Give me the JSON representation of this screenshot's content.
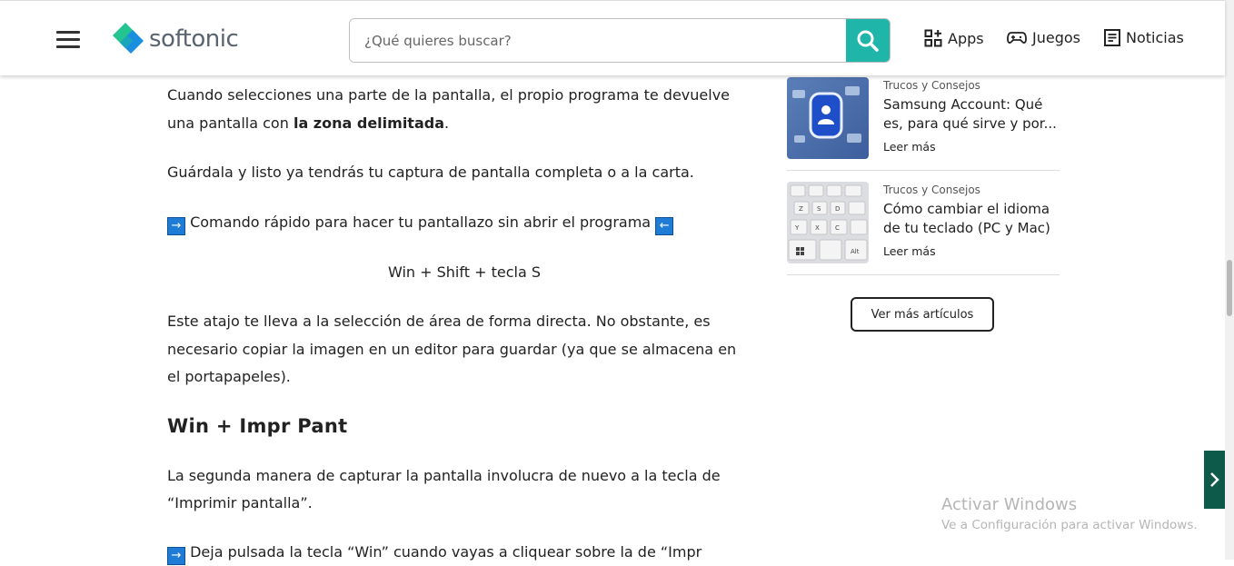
{
  "header": {
    "logo_text": "softonic",
    "search_placeholder": "¿Qué quieres buscar?",
    "nav": {
      "apps": "Apps",
      "juegos": "Juegos",
      "noticias": "Noticias"
    }
  },
  "article": {
    "p1_line1": "Cuando selecciones una parte de la pantalla, el propio programa te devuelve",
    "p1_line2_a": "una pantalla con ",
    "p1_line2_b": "la zona delimitada",
    "p1_line2_c": ".",
    "p2": "Guárdala y listo ya tendrás tu captura de pantalla completa o a la carta.",
    "arrow_left": "→",
    "arrow_right": "←",
    "cmd_heading": "Comando rápido para hacer tu pantallazo sin abrir el programa",
    "shortcut": "Win + Shift + tecla S",
    "p3_line1": "Este atajo te lleva a la selección de área de forma directa. No obstante, es",
    "p3_line2": "necesario copiar la imagen en un editor para guardar (ya que se almacena en",
    "p3_line3": "el portapapeles).",
    "h_win": "Win + Impr Pant",
    "p4_line1": "La segunda manera de capturar la pantalla involucra de nuevo a la tecla de",
    "p4_line2": "“Imprimir pantalla”.",
    "p5_cut": "Deja pulsada la tecla “Win” cuando vayas a cliquear sobre la de “Impr"
  },
  "sidebar": {
    "items": [
      {
        "category": "Trucos y Consejos",
        "title_line1": "Samsung Account: Qué",
        "title_line2": "es, para qué sirve y por...",
        "read": "Leer más"
      },
      {
        "category": "Trucos y Consejos",
        "title_line1": "Cómo cambiar el idioma",
        "title_line2": "de tu teclado (PC y Mac)",
        "read": "Leer más"
      }
    ],
    "more_button": "Ver más artículos"
  },
  "windows_watermark": {
    "line1": "Activar Windows",
    "line2": "Ve a Configuración para activar Windows."
  },
  "colors": {
    "brand_teal": "#1fb5a8",
    "arrow_blue": "#1e7bd6",
    "side_tab": "#0d5a4a"
  }
}
